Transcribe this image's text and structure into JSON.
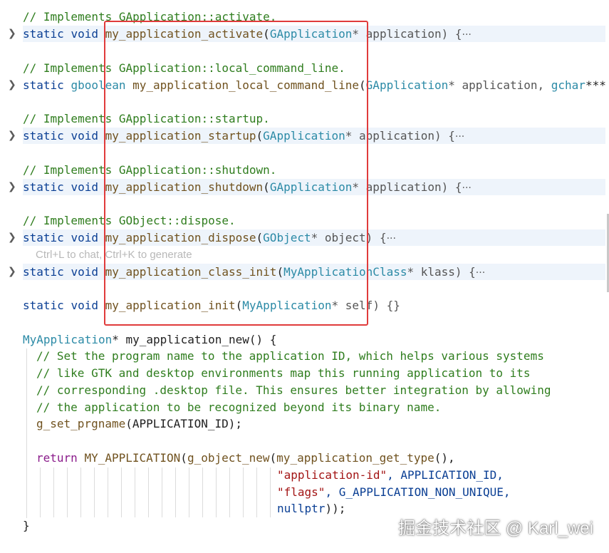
{
  "editor": {
    "lines": [
      {
        "id": "c-activate",
        "comment": "// Implements GApplication::activate."
      },
      {
        "id": "d-activate",
        "kw": "static",
        "ret": "void",
        "fn": "my_application_activate",
        "open": "(",
        "ptype": "GApplication",
        "rest": "* application) {",
        "fold": true
      },
      {
        "id": "c-local",
        "comment": "// Implements GApplication::local_command_line."
      },
      {
        "id": "d-local",
        "kw": "static",
        "ret": "gboolean",
        "fn": "my_application_local_command_line",
        "open": "(",
        "ptype": "GApplication",
        "rest": "* application, ",
        "ptype2": "gchar",
        "rest2": "***",
        "fold": true
      },
      {
        "id": "c-startup",
        "comment": "// Implements GApplication::startup."
      },
      {
        "id": "d-startup",
        "kw": "static",
        "ret": "void",
        "fn": "my_application_startup",
        "open": "(",
        "ptype": "GApplication",
        "rest": "* application) {",
        "fold": true
      },
      {
        "id": "c-shutdown",
        "comment": "// Implements GApplication::shutdown."
      },
      {
        "id": "d-shutdown",
        "kw": "static",
        "ret": "void",
        "fn": "my_application_shutdown",
        "open": "(",
        "ptype": "GApplication",
        "rest": "* application) {",
        "fold": true
      },
      {
        "id": "c-dispose",
        "comment": "// Implements GObject::dispose."
      },
      {
        "id": "d-dispose",
        "kw": "static",
        "ret": "void",
        "fn": "my_application_dispose",
        "open": "(",
        "ptype": "GObject",
        "rest": "* object) {",
        "fold": true
      },
      {
        "id": "d-class-init",
        "kw": "static",
        "ret": "void",
        "fn": "my_application_class_init",
        "open": "(",
        "ptype": "MyApplicationClass",
        "rest": "* klass) {",
        "fold": true
      },
      {
        "id": "d-init",
        "kw": "static",
        "ret": "void",
        "fn": "my_application_init",
        "open": "(",
        "ptype": "MyApplication",
        "rest": "* self) {}"
      }
    ],
    "hint": "Ctrl+L to chat, Ctrl+K to generate",
    "ellipsis": "···",
    "new_fn": {
      "type": "MyApplication",
      "sig": "* my_application_new() {",
      "comments": [
        "// Set the program name to the application ID, which helps various systems",
        "// like GTK and desktop environments map this running application to its",
        "// corresponding .desktop file. This ensures better integration by allowing",
        "// the application to be recognized beyond its binary name."
      ],
      "setname_fn": "g_set_prgname",
      "setname_args": "(APPLICATION_ID);",
      "return_kw": "return",
      "return_macro": "MY_APPLICATION",
      "return_open": "(",
      "new_fn": "g_object_new",
      "new_open": "(",
      "get_type": "my_application_get_type",
      "get_type_tail": "(),",
      "arg1_str": "\"application-id\"",
      "arg1_rest": ", APPLICATION_ID,",
      "arg2_str": "\"flags\"",
      "arg2_rest": ", G_APPLICATION_NON_UNIQUE,",
      "arg3": "nullptr",
      "arg3_tail": "));",
      "close": "}"
    }
  },
  "watermark": "掘金技术社区 @ Karl_wei"
}
